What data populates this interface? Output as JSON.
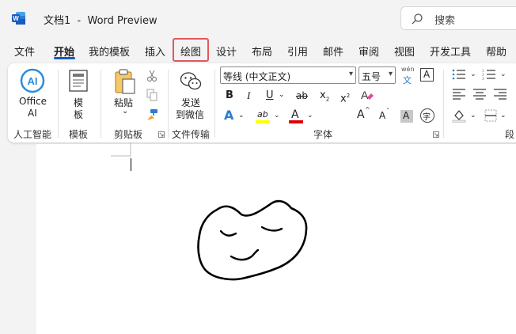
{
  "window": {
    "doc_name": "文档1",
    "separator": "-",
    "app_name": "Word Preview"
  },
  "search": {
    "placeholder": "搜索"
  },
  "tabs": [
    {
      "label": "文件"
    },
    {
      "label": "开始"
    },
    {
      "label": "我的模板"
    },
    {
      "label": "插入"
    },
    {
      "label": "绘图"
    },
    {
      "label": "设计"
    },
    {
      "label": "布局"
    },
    {
      "label": "引用"
    },
    {
      "label": "邮件"
    },
    {
      "label": "审阅"
    },
    {
      "label": "视图"
    },
    {
      "label": "开发工具"
    },
    {
      "label": "帮助"
    }
  ],
  "active_tab": "开始",
  "highlighted_tab": "绘图",
  "ribbon": {
    "office_ai": {
      "logo": "AI",
      "label_line1": "Office",
      "label_line2": "AI",
      "group": "人工智能"
    },
    "template": {
      "label_line1": "模",
      "label_line2": "板",
      "group": "模板"
    },
    "clipboard": {
      "paste_label": "粘贴",
      "group": "剪贴板"
    },
    "transfer": {
      "label_line1": "发送",
      "label_line2": "到微信",
      "group": "文件传输"
    },
    "font": {
      "font_name": "等线 (中文正文)",
      "font_size": "五号",
      "phonetic_top": "wén",
      "phonetic_bottom": "文",
      "border_char": "A",
      "bold": "B",
      "italic": "I",
      "underline": "U",
      "strike": "ab",
      "subscript": "x",
      "superscript": "x",
      "effects": "A",
      "highlight": "ab",
      "color": "A",
      "grow": "A",
      "shrink": "A",
      "shading": "A",
      "circle": "字",
      "group": "字体"
    },
    "paragraph": {
      "group": "段"
    }
  },
  "colors": {
    "accent": "#185abd",
    "highlight_box": "#e2575b",
    "highlight_yellow": "#ffff00",
    "font_red": "#e00000"
  }
}
